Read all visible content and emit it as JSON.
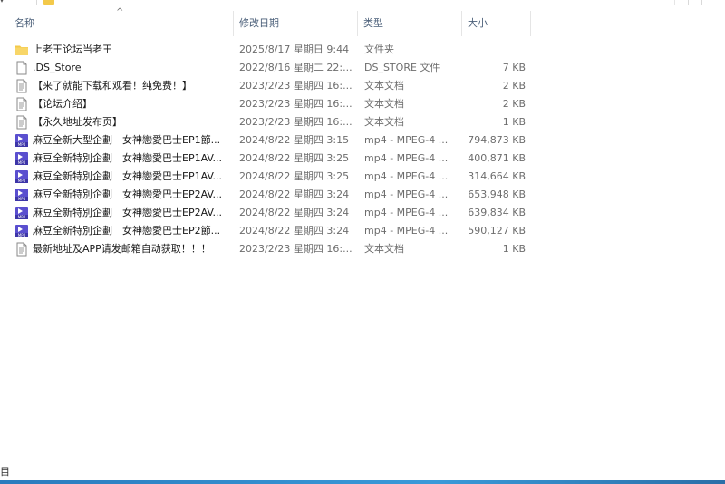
{
  "header": {
    "name": "名称",
    "date": "修改日期",
    "type": "类型",
    "size": "大小"
  },
  "files": [
    {
      "icon": "folder-icon",
      "name": "上老王论坛当老王",
      "date": "2025/8/17 星期日 9:44",
      "type": "文件夹",
      "size": ""
    },
    {
      "icon": "file-icon",
      "name": ".DS_Store",
      "date": "2022/8/16 星期二 22:...",
      "type": "DS_STORE 文件",
      "size": "7 KB"
    },
    {
      "icon": "text-doc-icon",
      "name": "【来了就能下载和观看！纯免费！】",
      "date": "2023/2/23 星期四 16:...",
      "type": "文本文档",
      "size": "2 KB"
    },
    {
      "icon": "text-doc-icon",
      "name": "【论坛介绍】",
      "date": "2023/2/23 星期四 16:...",
      "type": "文本文档",
      "size": "2 KB"
    },
    {
      "icon": "text-doc-icon",
      "name": "【永久地址发布页】",
      "date": "2023/2/23 星期四 16:...",
      "type": "文本文档",
      "size": "1 KB"
    },
    {
      "icon": "mp4-icon",
      "name": "麻豆全新大型企劃　女神戀愛巴士EP1節...",
      "date": "2024/8/22 星期四 3:15",
      "type": "mp4 - MPEG-4 ...",
      "size": "794,873 KB"
    },
    {
      "icon": "mp4-icon",
      "name": "麻豆全新特別企劃　女神戀愛巴士EP1AV...",
      "date": "2024/8/22 星期四 3:25",
      "type": "mp4 - MPEG-4 ...",
      "size": "400,871 KB"
    },
    {
      "icon": "mp4-icon",
      "name": "麻豆全新特別企劃　女神戀愛巴士EP1AV...",
      "date": "2024/8/22 星期四 3:25",
      "type": "mp4 - MPEG-4 ...",
      "size": "314,664 KB"
    },
    {
      "icon": "mp4-icon",
      "name": "麻豆全新特別企劃　女神戀愛巴士EP2AV...",
      "date": "2024/8/22 星期四 3:24",
      "type": "mp4 - MPEG-4 ...",
      "size": "653,948 KB"
    },
    {
      "icon": "mp4-icon",
      "name": "麻豆全新特別企劃　女神戀愛巴士EP2AV...",
      "date": "2024/8/22 星期四 3:24",
      "type": "mp4 - MPEG-4 ...",
      "size": "639,834 KB"
    },
    {
      "icon": "mp4-icon",
      "name": "麻豆全新特別企劃　女神戀愛巴士EP2節...",
      "date": "2024/8/22 星期四 3:24",
      "type": "mp4 - MPEG-4 ...",
      "size": "590,127 KB"
    },
    {
      "icon": "text-doc-icon",
      "name": "最新地址及APP请发邮箱自动获取！！！",
      "date": "2023/2/23 星期四 16:...",
      "type": "文本文档",
      "size": "1 KB"
    }
  ],
  "status_bar": {
    "fragment": "目"
  },
  "colors": {
    "folder": "#f3c94a",
    "mp4": "#5a4fcf",
    "header_text": "#4c607a",
    "taskbar": "#2a7bbd"
  }
}
